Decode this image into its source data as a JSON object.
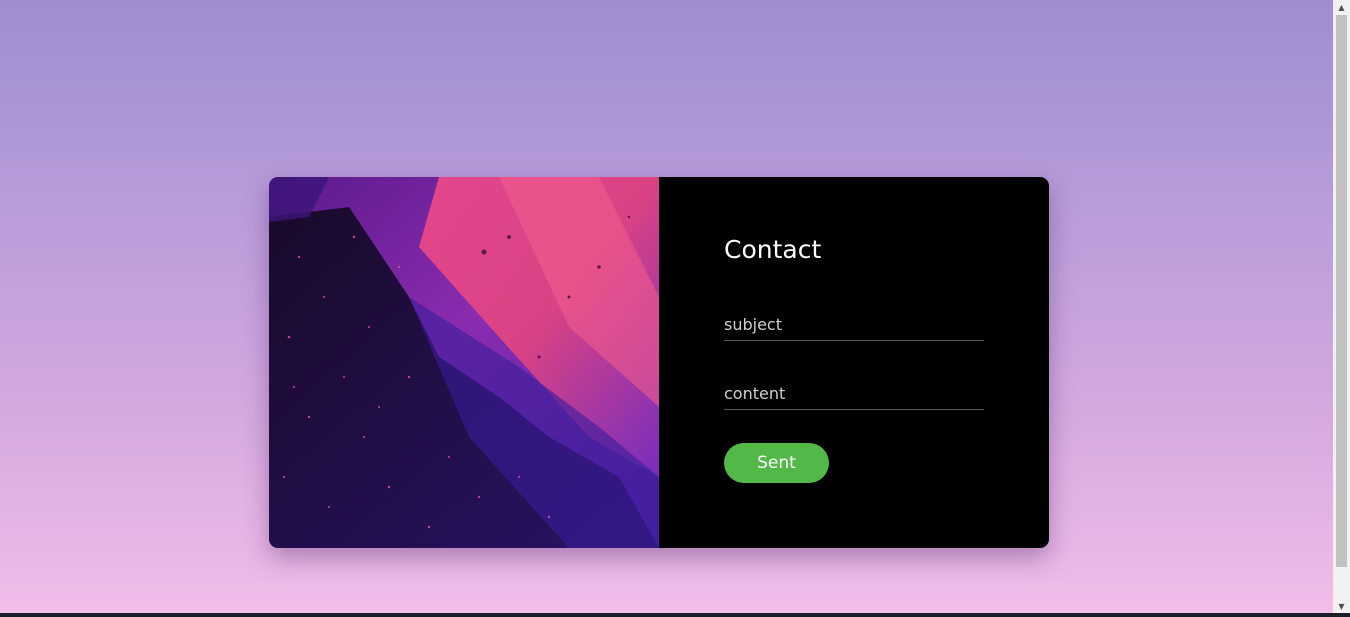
{
  "contact": {
    "title": "Contact",
    "subject_placeholder": "subject",
    "subject_value": "",
    "content_placeholder": "content",
    "content_value": "",
    "send_label": "Sent"
  },
  "colors": {
    "card_right_bg": "#000000",
    "send_button": "#52b848",
    "page_gradient_top": "#9f8dd0",
    "page_gradient_bottom": "#f2bde8"
  },
  "icons": {
    "scroll_up": "scroll-up-arrow-icon",
    "scroll_down": "scroll-down-arrow-icon"
  }
}
